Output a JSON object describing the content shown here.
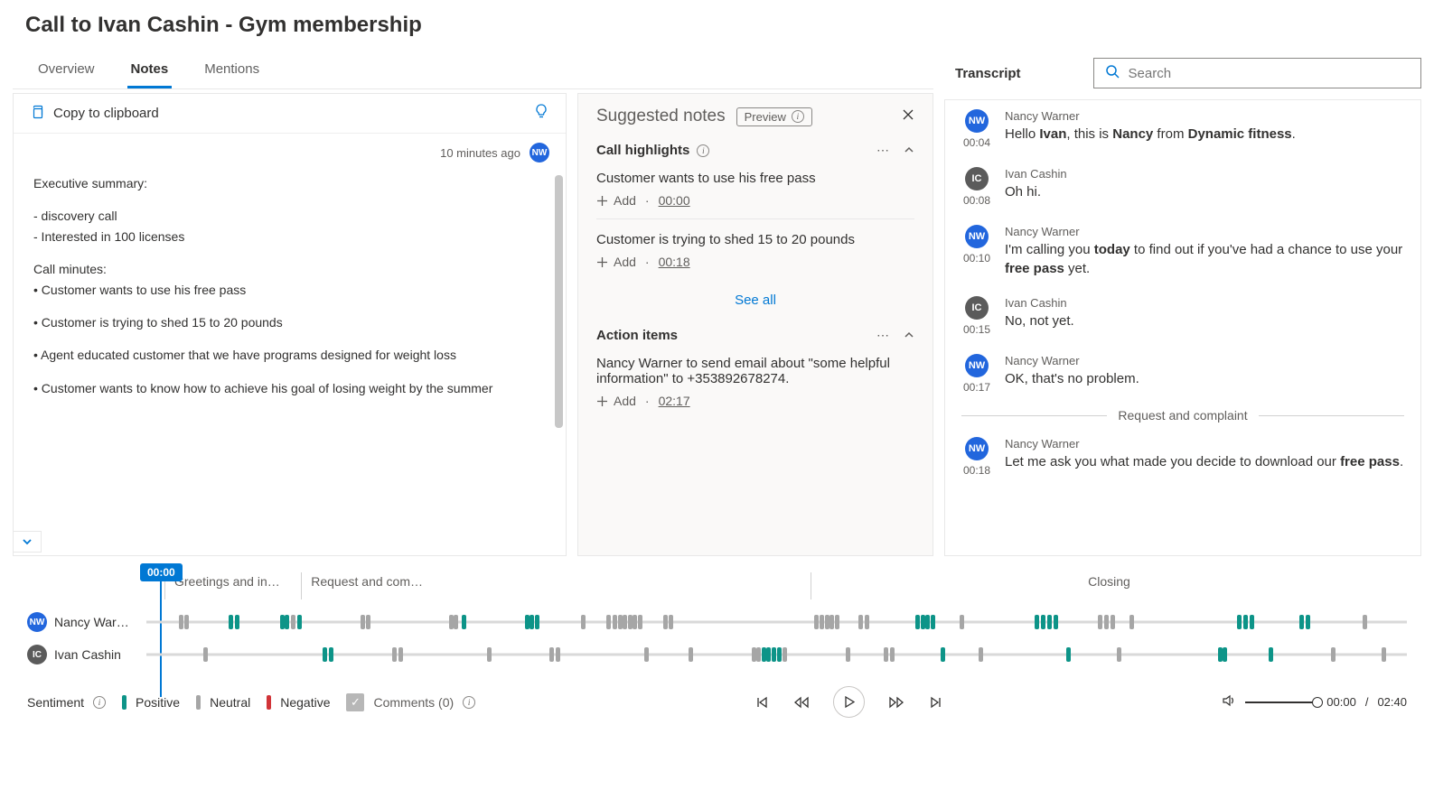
{
  "page_title": "Call to Ivan Cashin - Gym membership",
  "tabs": [
    "Overview",
    "Notes",
    "Mentions"
  ],
  "active_tab": 1,
  "copy_label": "Copy to clipboard",
  "notes_meta_time": "10 minutes ago",
  "notes_author_initials": "NW",
  "notes_body": {
    "h1": "Executive summary:",
    "b1": "- discovery call",
    "b2": "- Interested in 100 licenses",
    "h2": "Call minutes:",
    "m1": "• Customer wants to use his free pass",
    "m2": "• Customer is trying to shed 15 to 20 pounds",
    "m3": "• Agent educated customer that we have programs designed for weight loss",
    "m4": "• Customer wants to know how to achieve his goal of losing weight by the summer"
  },
  "suggested": {
    "title": "Suggested notes",
    "preview": "Preview",
    "highlights_title": "Call highlights",
    "highlights": [
      {
        "text": "Customer wants to use his free pass",
        "ts": "00:00"
      },
      {
        "text": "Customer is trying to shed 15 to 20 pounds",
        "ts": "00:18"
      }
    ],
    "add_label": "Add",
    "see_all": "See all",
    "actions_title": "Action items",
    "action_text": "Nancy Warner to send email about \"some helpful information\" to +353892678274.",
    "action_ts": "02:17"
  },
  "transcript_label": "Transcript",
  "search_placeholder": "Search",
  "transcript": [
    {
      "who": "NW",
      "name": "Nancy Warner",
      "time": "00:04",
      "html": "Hello <b>Ivan</b>, this is <b>Nancy</b> from <b>Dynamic fitness</b>."
    },
    {
      "who": "IC",
      "name": "Ivan Cashin",
      "time": "00:08",
      "html": "Oh hi."
    },
    {
      "who": "NW",
      "name": "Nancy Warner",
      "time": "00:10",
      "html": "I'm calling you <b>today</b> to find out if you've had a chance to use your <b>free pass</b> yet."
    },
    {
      "who": "IC",
      "name": "Ivan Cashin",
      "time": "00:15",
      "html": "No, not yet."
    },
    {
      "who": "NW",
      "name": "Nancy Warner",
      "time": "00:17",
      "html": "OK, that's no problem."
    },
    {
      "divider": "Request and complaint"
    },
    {
      "who": "NW",
      "name": "Nancy Warner",
      "time": "00:18",
      "html": "Let me ask you what made you decide to download our <b>free pass</b>."
    }
  ],
  "timeline": {
    "flag": "00:00",
    "segments": [
      {
        "label": "Greetings and in…",
        "width": "11%"
      },
      {
        "label": "Request and com…",
        "width": "41%"
      },
      {
        "label": "Closing",
        "width": "48%",
        "center": true
      }
    ],
    "tracks": [
      {
        "initials": "NW",
        "cls": "nw",
        "label": "Nancy War…",
        "ticks": [
          [
            2.6,
            "n"
          ],
          [
            3,
            "n"
          ],
          [
            6.5,
            "p"
          ],
          [
            7,
            "p"
          ],
          [
            10.6,
            "p"
          ],
          [
            11,
            "p"
          ],
          [
            11.5,
            "n"
          ],
          [
            12,
            "p"
          ],
          [
            17,
            "n"
          ],
          [
            17.4,
            "n"
          ],
          [
            24,
            "n"
          ],
          [
            24.4,
            "n"
          ],
          [
            25,
            "p"
          ],
          [
            30,
            "p"
          ],
          [
            30.4,
            "p"
          ],
          [
            30.8,
            "p"
          ],
          [
            34.5,
            "n"
          ],
          [
            36.5,
            "n"
          ],
          [
            37,
            "n"
          ],
          [
            37.4,
            "n"
          ],
          [
            37.8,
            "n"
          ],
          [
            38.2,
            "n"
          ],
          [
            38.6,
            "n"
          ],
          [
            39,
            "n"
          ],
          [
            41,
            "n"
          ],
          [
            41.4,
            "n"
          ],
          [
            53,
            "n"
          ],
          [
            53.4,
            "n"
          ],
          [
            53.8,
            "n"
          ],
          [
            54.2,
            "n"
          ],
          [
            54.6,
            "n"
          ],
          [
            56.5,
            "n"
          ],
          [
            57,
            "n"
          ],
          [
            61,
            "p"
          ],
          [
            61.4,
            "p"
          ],
          [
            61.8,
            "p"
          ],
          [
            62.2,
            "p"
          ],
          [
            64.5,
            "n"
          ],
          [
            70.5,
            "p"
          ],
          [
            71,
            "p"
          ],
          [
            71.5,
            "p"
          ],
          [
            72,
            "p"
          ],
          [
            75.5,
            "n"
          ],
          [
            76,
            "n"
          ],
          [
            76.5,
            "n"
          ],
          [
            78,
            "n"
          ],
          [
            86.5,
            "p"
          ],
          [
            87,
            "p"
          ],
          [
            87.5,
            "p"
          ],
          [
            91.5,
            "p"
          ],
          [
            92,
            "p"
          ],
          [
            96.5,
            "n"
          ]
        ]
      },
      {
        "initials": "IC",
        "cls": "ic",
        "label": "Ivan Cashin",
        "ticks": [
          [
            4.5,
            "n"
          ],
          [
            14,
            "p"
          ],
          [
            14.5,
            "p"
          ],
          [
            19.5,
            "n"
          ],
          [
            20,
            "n"
          ],
          [
            27,
            "n"
          ],
          [
            32,
            "n"
          ],
          [
            32.5,
            "n"
          ],
          [
            39.5,
            "n"
          ],
          [
            43,
            "n"
          ],
          [
            48,
            "n"
          ],
          [
            48.4,
            "n"
          ],
          [
            48.8,
            "p"
          ],
          [
            49.2,
            "p"
          ],
          [
            49.6,
            "p"
          ],
          [
            50,
            "p"
          ],
          [
            50.5,
            "n"
          ],
          [
            55.5,
            "n"
          ],
          [
            58.5,
            "n"
          ],
          [
            59,
            "n"
          ],
          [
            63,
            "p"
          ],
          [
            66,
            "n"
          ],
          [
            73,
            "p"
          ],
          [
            77,
            "n"
          ],
          [
            85,
            "p"
          ],
          [
            85.4,
            "p"
          ],
          [
            89,
            "p"
          ],
          [
            94,
            "n"
          ],
          [
            98,
            "n"
          ]
        ]
      }
    ]
  },
  "legend": {
    "title": "Sentiment",
    "pos": "Positive",
    "neu": "Neutral",
    "neg": "Negative"
  },
  "comments_label": "Comments (0)",
  "time": {
    "current": "00:00",
    "total": "02:40"
  }
}
